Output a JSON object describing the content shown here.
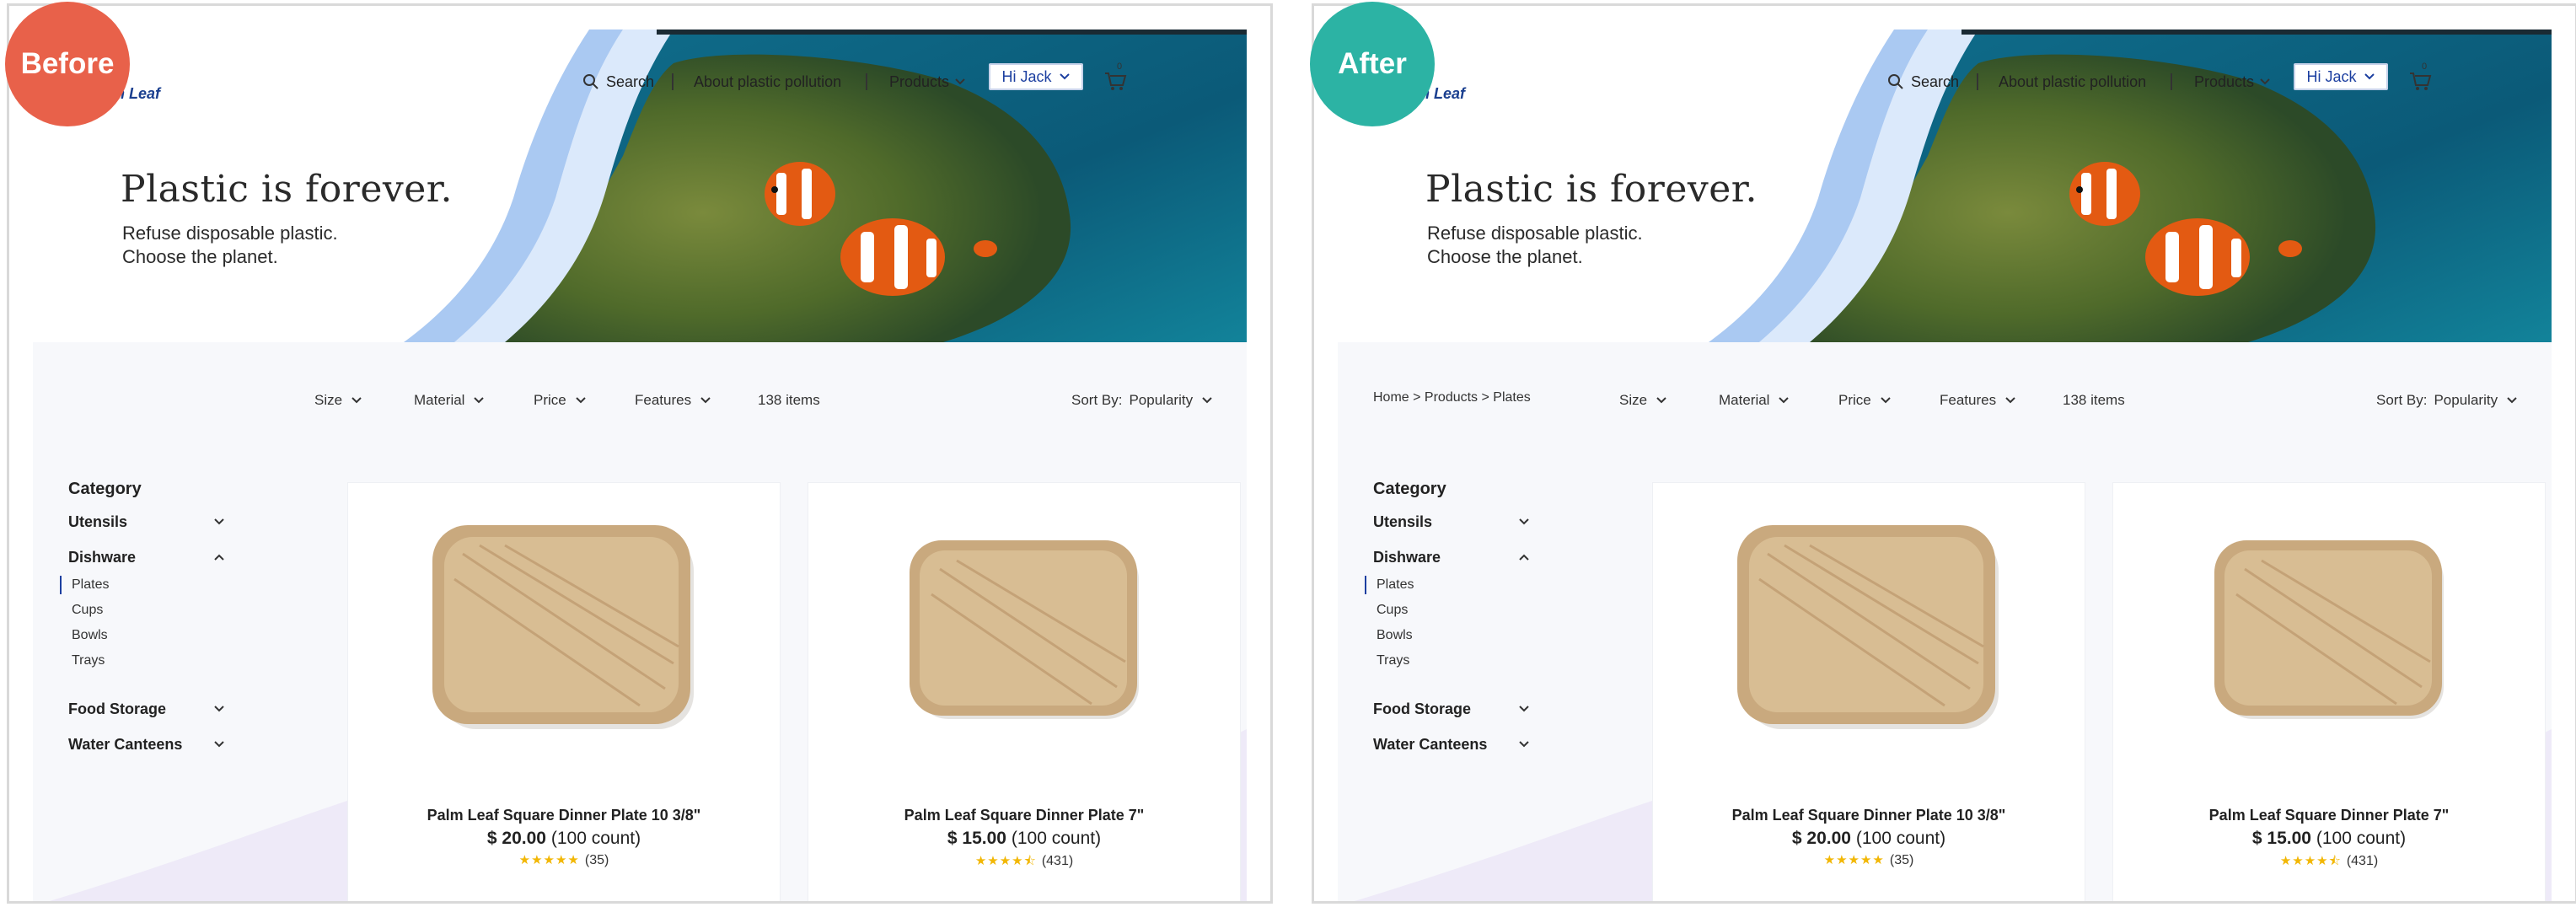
{
  "badges": {
    "before": "Before",
    "after": "After"
  },
  "brand": {
    "logo_text": "an Leaf"
  },
  "nav": {
    "search": "Search",
    "about": "About plastic pollution",
    "products": "Products",
    "user": "Hi Jack",
    "cart_count": "0"
  },
  "hero": {
    "title": "Plastic is forever.",
    "subtitle_line1": "Refuse disposable plastic.",
    "subtitle_line2": "Choose the planet."
  },
  "breadcrumb": "Home > Products > Plates",
  "filters": {
    "size": "Size",
    "material": "Material",
    "price": "Price",
    "features": "Features",
    "count": "138 items",
    "sort_label": "Sort By:",
    "sort_value": "Popularity"
  },
  "sidebar": {
    "title": "Category",
    "categories": [
      {
        "label": "Utensils"
      },
      {
        "label": "Dishware"
      },
      {
        "label": "Food Storage"
      },
      {
        "label": "Water Canteens"
      }
    ],
    "dishware_items": [
      "Plates",
      "Cups",
      "Bowls",
      "Trays"
    ]
  },
  "products": [
    {
      "name": "Palm Leaf Square Dinner Plate  10 3/8\"",
      "price": "$ 20.00",
      "count": "(100 count)",
      "stars": "★★★★★",
      "reviews": "(35)"
    },
    {
      "name": "Palm Leaf Square Dinner Plate  7\"",
      "price": "$ 15.00",
      "count": "(100 count)",
      "stars": "★★★★⯪",
      "reviews": "(431)"
    }
  ],
  "colors": {
    "accent": "#1c3fa0",
    "before_badge": "#e8614a",
    "after_badge": "#2cb3a4",
    "star": "#f2b705"
  }
}
